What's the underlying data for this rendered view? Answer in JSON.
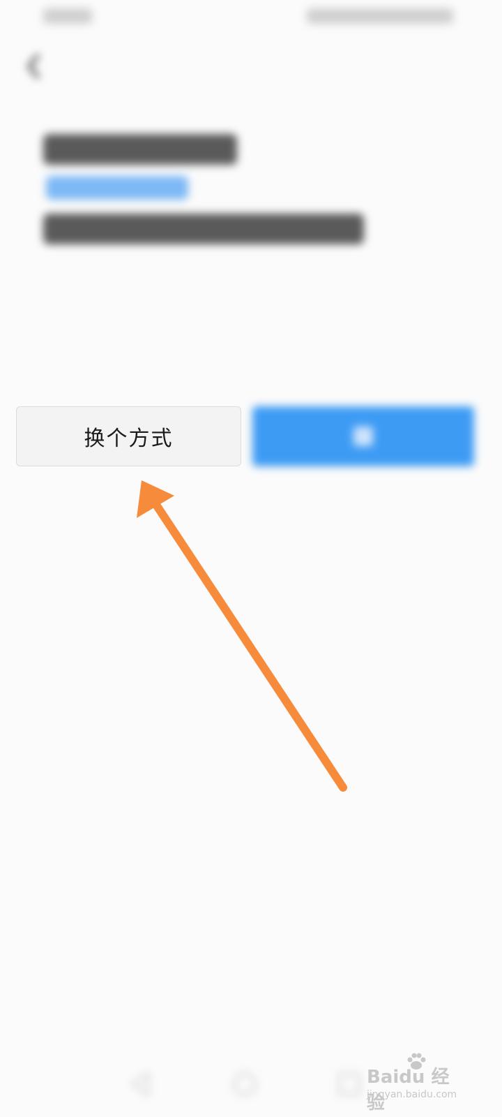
{
  "buttons": {
    "change_method_label": "换个方式"
  },
  "icons": {
    "back": "back-arrow-icon",
    "nav_back": "triangle-back-icon",
    "nav_home": "circle-home-icon",
    "nav_recent": "square-recent-icon",
    "paw": "baidu-paw-icon"
  },
  "annotation": {
    "arrow_color": "#f78b3c"
  },
  "colors": {
    "primary": "#3d9bf4",
    "secondary_button_bg": "#f3f3f3",
    "background": "#fbfbfb",
    "link_text": "#7db8f6"
  },
  "watermark": {
    "logo_text": "Baidu 经验",
    "sub_text": "jingyan.baidu.com"
  }
}
